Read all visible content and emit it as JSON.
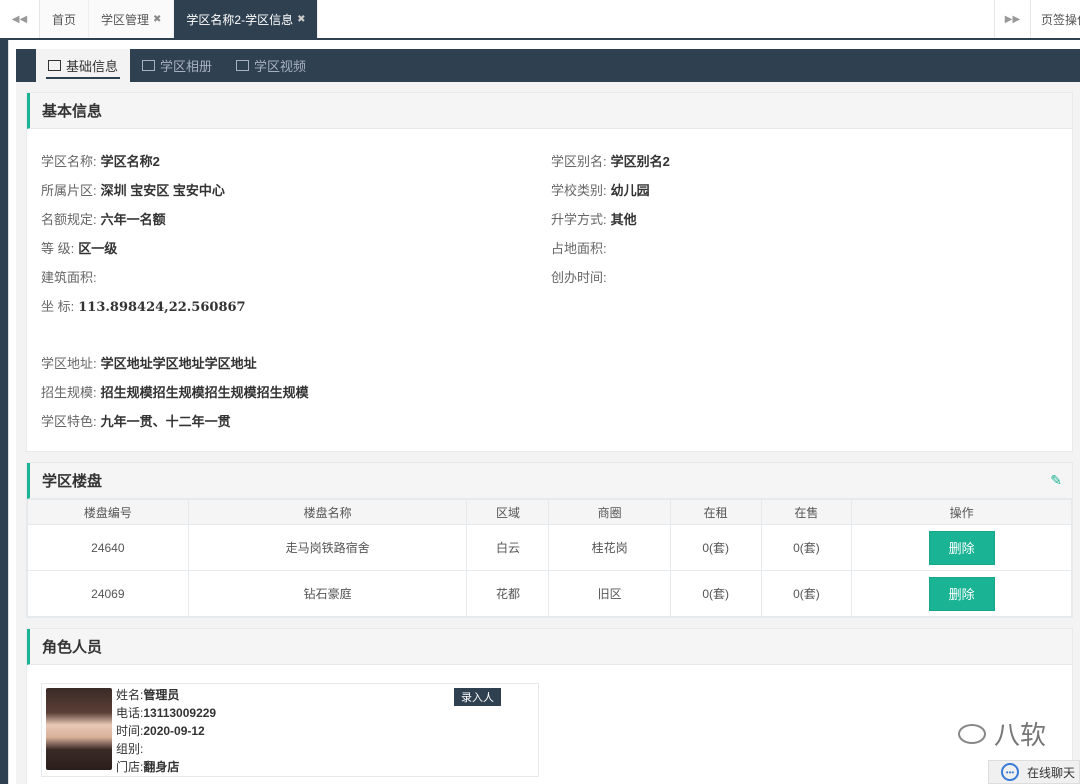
{
  "tabbar": {
    "prev_icon": "double-left-arrow",
    "tabs": [
      {
        "label": "首页",
        "closable": false,
        "active": false
      },
      {
        "label": "学区管理",
        "closable": true,
        "active": false
      },
      {
        "label": "学区名称2-学区信息",
        "closable": true,
        "active": true
      }
    ],
    "close_glyph": "✖",
    "next_icon": "double-right-arrow",
    "ops_label": "页签操作"
  },
  "subtabs": [
    {
      "label": "基础信息",
      "icon": "building-icon",
      "active": true
    },
    {
      "label": "学区相册",
      "icon": "image-icon",
      "active": false
    },
    {
      "label": "学区视频",
      "icon": "video-icon",
      "active": false
    }
  ],
  "basic": {
    "title": "基本信息",
    "fields": {
      "name": {
        "label": "学区名称:",
        "value": "学区名称2"
      },
      "alias": {
        "label": "学区别名:",
        "value": "学区别名2"
      },
      "district": {
        "label": "所属片区:",
        "value": "深圳 宝安区 宝安中心"
      },
      "school_type": {
        "label": "学校类别:",
        "value": "幼儿园"
      },
      "quota": {
        "label": "名额规定:",
        "value": "六年一名额"
      },
      "admission": {
        "label": "升学方式:",
        "value": "其他"
      },
      "level": {
        "label": "等 级:",
        "value": "区一级"
      },
      "land_area": {
        "label": "占地面积:",
        "value": ""
      },
      "build_area": {
        "label": "建筑面积:",
        "value": ""
      },
      "founded": {
        "label": "创办时间:",
        "value": ""
      },
      "coords": {
        "label": "坐 标:",
        "value": "113.898424,22.560867"
      },
      "address": {
        "label": "学区地址:",
        "value": "学区地址学区地址学区地址"
      },
      "scale": {
        "label": "招生规模:",
        "value": "招生规模招生规模招生规模招生规模"
      },
      "feature": {
        "label": "学区特色:",
        "value": "九年一贯、十二年一贯"
      }
    }
  },
  "buildings": {
    "title": "学区楼盘",
    "edit_icon": "pencil-icon",
    "columns": [
      "楼盘编号",
      "楼盘名称",
      "区域",
      "商圈",
      "在租",
      "在售",
      "操作"
    ],
    "rows": [
      {
        "id": "24640",
        "name": "走马岗铁路宿舍",
        "area": "白云",
        "zone": "桂花岗",
        "rent": "0(套)",
        "sale": "0(套)",
        "action": "删除"
      },
      {
        "id": "24069",
        "name": "钻石豪庭",
        "area": "花都",
        "zone": "旧区",
        "rent": "0(套)",
        "sale": "0(套)",
        "action": "删除"
      }
    ]
  },
  "roles": {
    "title": "角色人员",
    "person": {
      "name_label": "姓名:",
      "name": "管理员",
      "phone_label": "电话:",
      "phone": "13113009229",
      "time_label": "时间:",
      "time": "2020-09-12",
      "group_label": "组别:",
      "group": "",
      "store_label": "门店:",
      "store": "翻身店",
      "badge": "录入人"
    }
  },
  "watermark": "八软",
  "chat": {
    "label": "在线聊天"
  },
  "colors": {
    "accent": "#1ab394",
    "nav": "#2f4050"
  }
}
